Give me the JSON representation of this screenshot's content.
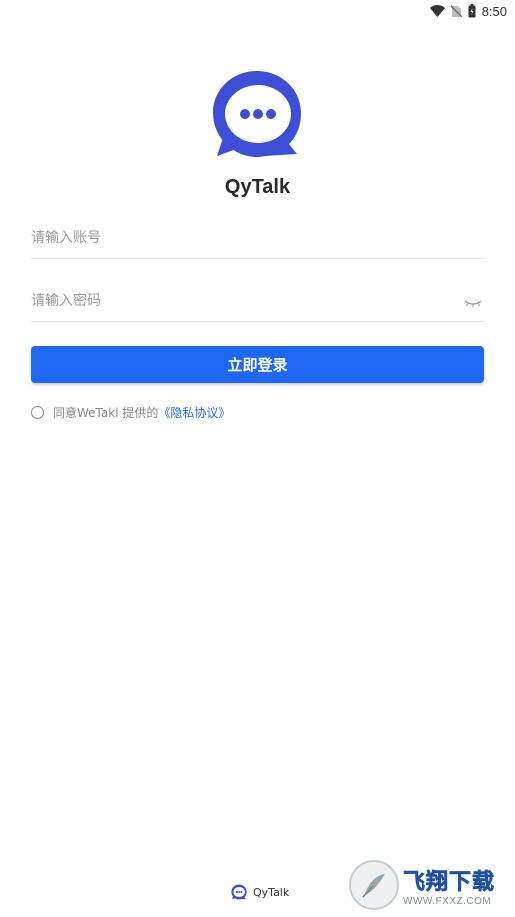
{
  "status_bar": {
    "time": "8:50",
    "icons": [
      "wifi-icon",
      "no-sim-icon",
      "battery-icon"
    ]
  },
  "brand": {
    "app_name": "QyTalk",
    "logo_icon": "chat-bubble-icon",
    "logo_color": "#3d4fd6"
  },
  "login": {
    "account_placeholder": "请输入账号",
    "password_placeholder": "请输入密码",
    "password_toggle_icon": "eye-closed-icon",
    "submit_label": "立即登录",
    "accent_color": "#1f68f3"
  },
  "agreement": {
    "checked": false,
    "text": "同意WeTakl 提供的",
    "link_text": "《隐私协议》"
  },
  "footer": {
    "app_name": "QyTalk"
  },
  "watermark": {
    "title": "飞翔下载",
    "url": "WWW.FXXZ.COM"
  }
}
